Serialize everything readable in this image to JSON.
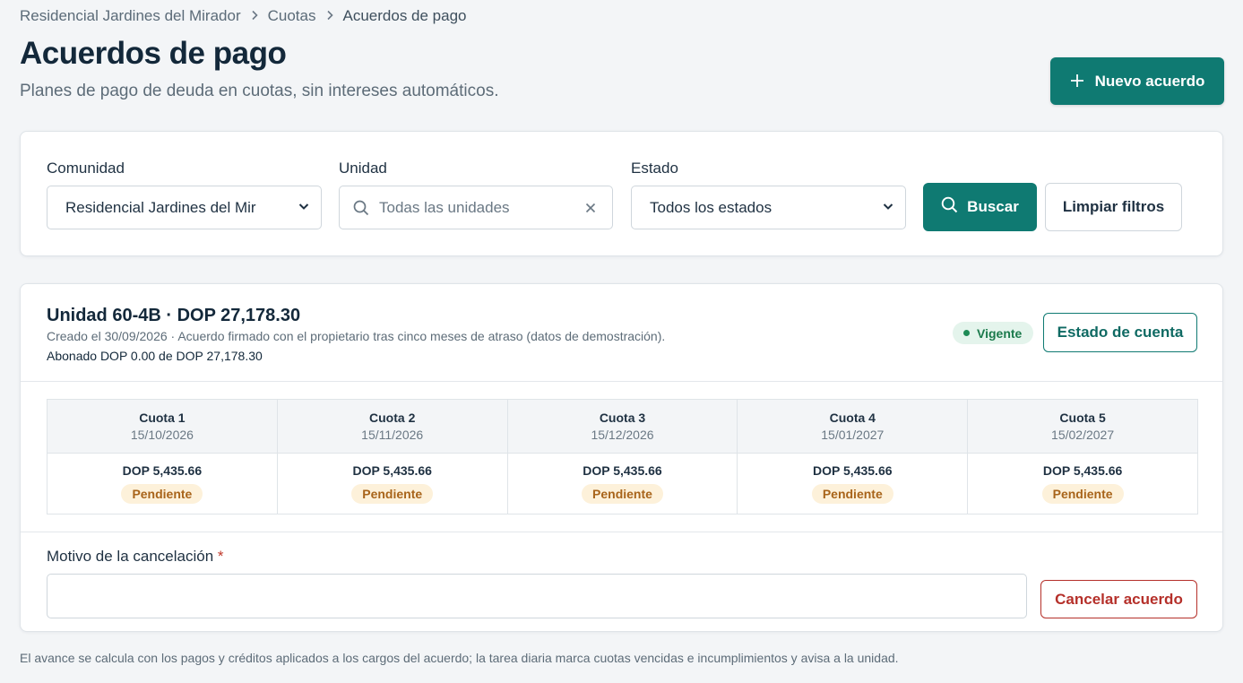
{
  "breadcrumb": {
    "items": [
      "Residencial Jardines del Mirador",
      "Cuotas"
    ],
    "current": "Acuerdos de pago"
  },
  "header": {
    "title": "Acuerdos de pago",
    "subtitle": "Planes de pago de deuda en cuotas, sin intereses automáticos.",
    "new_button": "Nuevo acuerdo"
  },
  "filters": {
    "community_label": "Comunidad",
    "community_value": "Residencial Jardines del Mir",
    "unit_label": "Unidad",
    "unit_placeholder": "Todas las unidades",
    "status_label": "Estado",
    "status_value": "Todos los estados",
    "search_button": "Buscar",
    "clear_button": "Limpiar filtros"
  },
  "agreement": {
    "title": "Unidad 60-4B · DOP 27,178.30",
    "meta": "Creado el 30/09/2026 · Acuerdo firmado con el propietario tras cinco meses de atraso (datos de demostración).",
    "paid": "Abonado DOP 0.00 de DOP 27,178.30",
    "status_badge": "Vigente",
    "statement_button": "Estado de cuenta",
    "installments": [
      {
        "name": "Cuota 1",
        "date": "15/10/2026",
        "amount": "DOP 5,435.66",
        "status": "Pendiente"
      },
      {
        "name": "Cuota 2",
        "date": "15/11/2026",
        "amount": "DOP 5,435.66",
        "status": "Pendiente"
      },
      {
        "name": "Cuota 3",
        "date": "15/12/2026",
        "amount": "DOP 5,435.66",
        "status": "Pendiente"
      },
      {
        "name": "Cuota 4",
        "date": "15/01/2027",
        "amount": "DOP 5,435.66",
        "status": "Pendiente"
      },
      {
        "name": "Cuota 5",
        "date": "15/02/2027",
        "amount": "DOP 5,435.66",
        "status": "Pendiente"
      }
    ],
    "reason_label": "Motivo de la cancelación",
    "reason_required": "*",
    "reason_value": "",
    "cancel_button": "Cancelar acuerdo"
  },
  "footnote": "El avance se calcula con los pagos y créditos aplicados a los cargos del acuerdo; la tarea diaria marca cuotas vencidas e incumplimientos y avisa a la unidad.",
  "colors": {
    "primary": "#0f7a72",
    "danger": "#b5302a",
    "success_badge_bg": "#e4f4ec",
    "pending_badge_bg": "#fdf1da",
    "pending_text": "#a8641a"
  },
  "icons": [
    "chevron-right-icon",
    "plus-icon",
    "chevron-down-icon",
    "search-icon",
    "clear-icon",
    "status-dot-icon"
  ]
}
